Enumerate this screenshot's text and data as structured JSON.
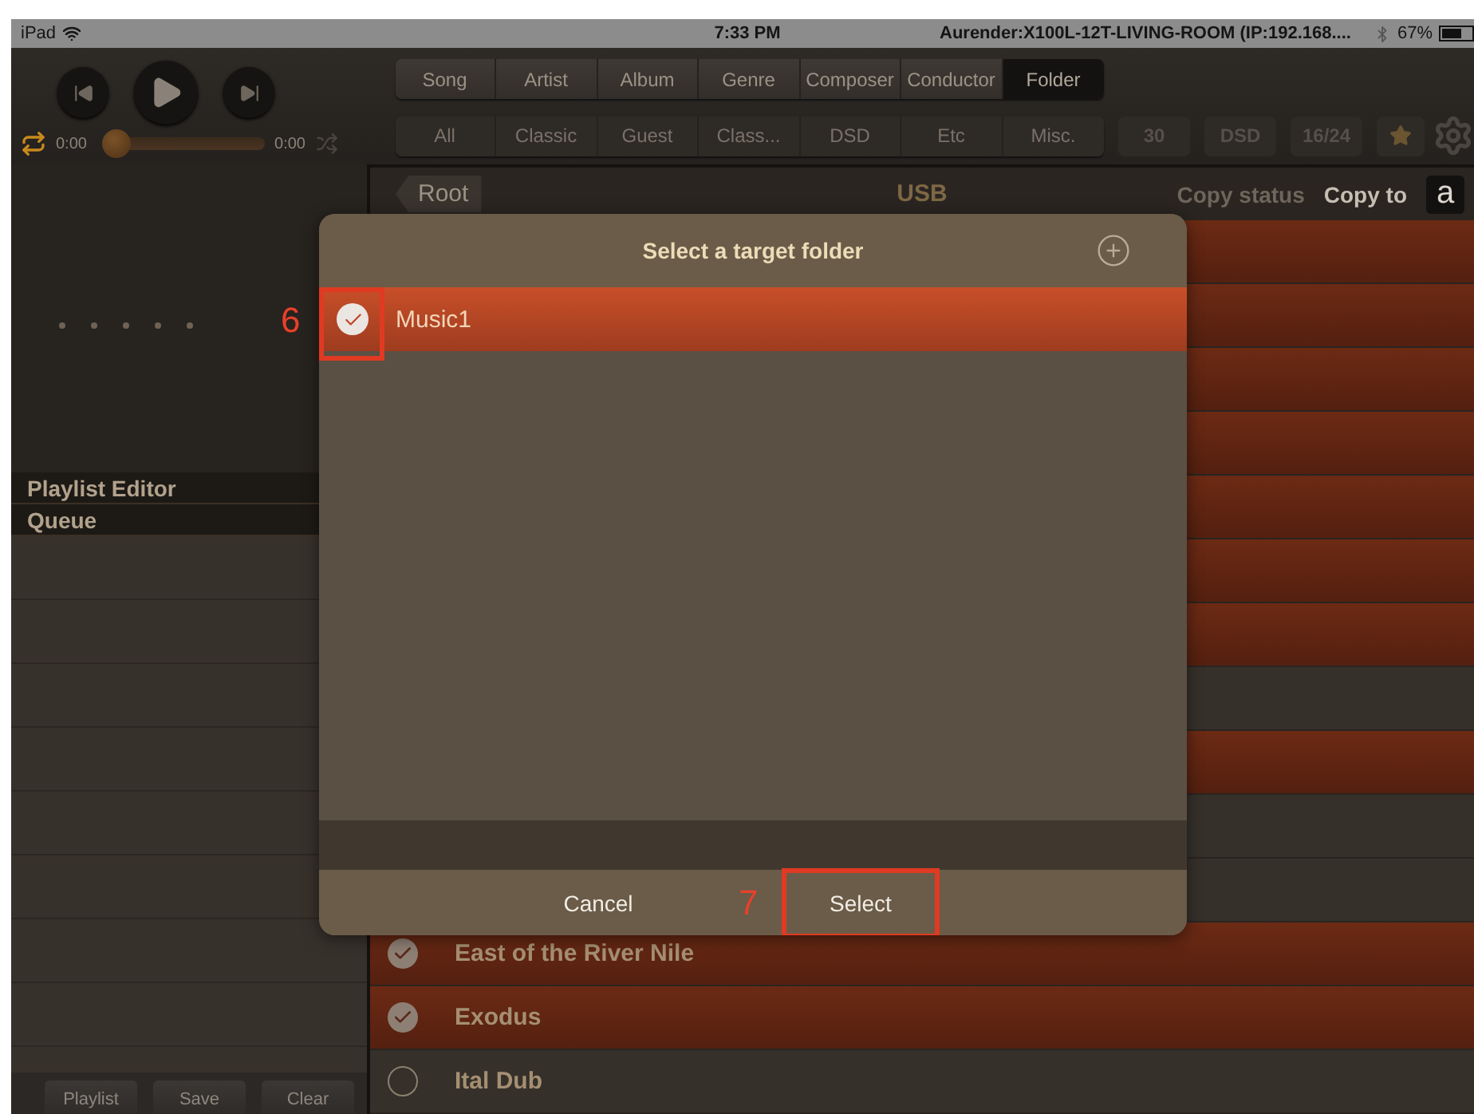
{
  "status_bar": {
    "device": "iPad",
    "time": "7:33 PM",
    "connection": "Aurender:X100L-12T-LIVING-ROOM (IP:192.168....",
    "battery": "67%"
  },
  "player": {
    "elapsed": "0:00",
    "duration": "0:00",
    "level": 0
  },
  "category_tabs": [
    {
      "label": "Song",
      "selected": false
    },
    {
      "label": "Artist",
      "selected": false
    },
    {
      "label": "Album",
      "selected": false
    },
    {
      "label": "Genre",
      "selected": false
    },
    {
      "label": "Composer",
      "selected": false
    },
    {
      "label": "Conductor",
      "selected": false
    },
    {
      "label": "Folder",
      "selected": true
    }
  ],
  "filter_tabs": [
    {
      "label": "All",
      "disabled": true
    },
    {
      "label": "Classic",
      "disabled": true
    },
    {
      "label": "Guest",
      "disabled": true
    },
    {
      "label": "Class...",
      "disabled": true
    },
    {
      "label": "DSD",
      "disabled": true
    },
    {
      "label": "Etc",
      "disabled": true
    },
    {
      "label": "Misc.",
      "disabled": true
    }
  ],
  "quick_filters": [
    {
      "kind": "text",
      "label": "30"
    },
    {
      "kind": "text",
      "label": "DSD"
    },
    {
      "kind": "text",
      "label": "16/24"
    },
    {
      "kind": "star"
    }
  ],
  "sidebar": {
    "sections": [
      {
        "label": "Playlist Editor"
      },
      {
        "label": "Queue"
      }
    ],
    "buttons": [
      "Playlist",
      "Save",
      "Clear"
    ]
  },
  "browser": {
    "back": "Root",
    "title": "USB",
    "actions": [
      {
        "label": "Copy status",
        "disabled": true
      },
      {
        "label": "Copy to",
        "disabled": false
      }
    ],
    "index_button": "a",
    "rows": [
      {
        "checked": true
      },
      {
        "checked": true
      },
      {
        "checked": true
      },
      {
        "checked": true
      },
      {
        "checked": true
      },
      {
        "checked": true
      },
      {
        "checked": true
      },
      {
        "checked": false
      },
      {
        "checked": true
      },
      {
        "checked": false
      },
      {
        "checked": false
      },
      {
        "title": "East of the River Nile",
        "checked": true
      },
      {
        "title": "Exodus",
        "checked": true
      },
      {
        "title": "Ital Dub",
        "checked": false
      }
    ]
  },
  "dialog": {
    "title": "Select a target folder",
    "folders": [
      {
        "name": "Music1",
        "selected": true
      }
    ],
    "buttons": [
      {
        "label": "Cancel"
      },
      {
        "label": "Select"
      }
    ]
  },
  "callouts": [
    {
      "label": "6"
    },
    {
      "label": "7"
    }
  ]
}
